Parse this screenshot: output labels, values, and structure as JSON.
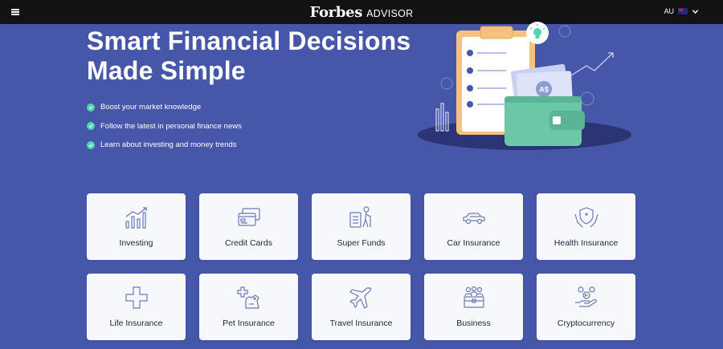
{
  "header": {
    "brand_name": "Forbes",
    "brand_suffix": "ADVISOR",
    "locale": "AU"
  },
  "hero": {
    "title": "Smart Financial Decisions Made Simple",
    "benefits": [
      "Boost your market knowledge",
      "Follow the latest in personal finance news",
      "Learn about investing and money trends"
    ]
  },
  "illustration": {
    "coin_label": "A$"
  },
  "categories": [
    {
      "label": "Investing",
      "icon": "bar-chart-icon"
    },
    {
      "label": "Credit Cards",
      "icon": "credit-card-icon"
    },
    {
      "label": "Super Funds",
      "icon": "super-funds-icon"
    },
    {
      "label": "Car Insurance",
      "icon": "car-icon"
    },
    {
      "label": "Health Insurance",
      "icon": "health-shield-icon"
    },
    {
      "label": "Life Insurance",
      "icon": "plus-cross-icon"
    },
    {
      "label": "Pet Insurance",
      "icon": "pet-icon"
    },
    {
      "label": "Travel Insurance",
      "icon": "airplane-icon"
    },
    {
      "label": "Business",
      "icon": "business-people-icon"
    },
    {
      "label": "Cryptocurrency",
      "icon": "crypto-hand-icon"
    }
  ],
  "colors": {
    "background": "#4656a8",
    "topbar": "#121212",
    "check": "#4fd8b0",
    "card": "#f7f8fb",
    "icon_stroke": "#6b79b5",
    "wallet": "#6cc7a7",
    "clipboard": "#f4c27e"
  }
}
